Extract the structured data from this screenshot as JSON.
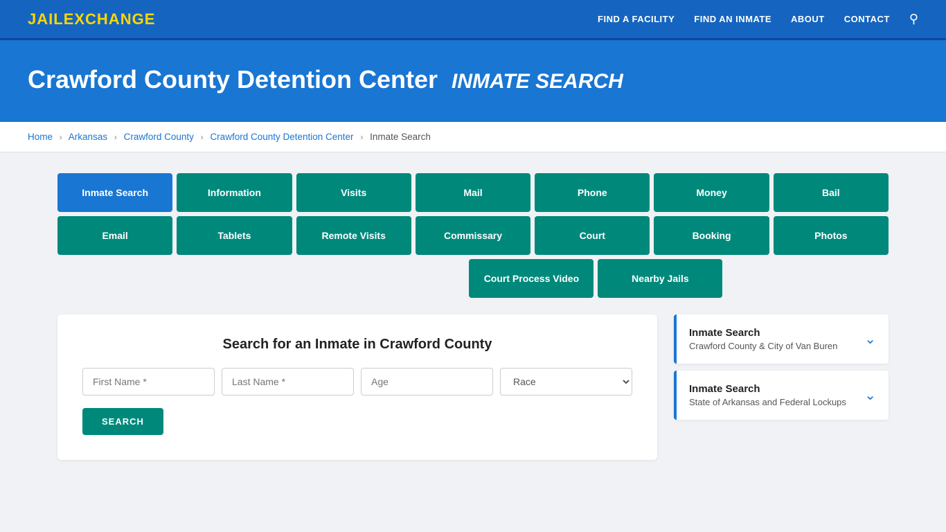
{
  "navbar": {
    "logo_jail": "JAIL",
    "logo_exchange": "EXCHANGE",
    "links": [
      {
        "label": "FIND A FACILITY",
        "href": "#"
      },
      {
        "label": "FIND AN INMATE",
        "href": "#"
      },
      {
        "label": "ABOUT",
        "href": "#"
      },
      {
        "label": "CONTACT",
        "href": "#"
      }
    ]
  },
  "hero": {
    "title": "Crawford County Detention Center",
    "subtitle": "INMATE SEARCH"
  },
  "breadcrumb": {
    "items": [
      {
        "label": "Home",
        "href": "#"
      },
      {
        "label": "Arkansas",
        "href": "#"
      },
      {
        "label": "Crawford County",
        "href": "#"
      },
      {
        "label": "Crawford County Detention Center",
        "href": "#"
      },
      {
        "label": "Inmate Search",
        "href": null
      }
    ]
  },
  "nav_buttons": {
    "row1": [
      {
        "label": "Inmate Search",
        "active": true
      },
      {
        "label": "Information",
        "active": false
      },
      {
        "label": "Visits",
        "active": false
      },
      {
        "label": "Mail",
        "active": false
      },
      {
        "label": "Phone",
        "active": false
      },
      {
        "label": "Money",
        "active": false
      },
      {
        "label": "Bail",
        "active": false
      }
    ],
    "row2": [
      {
        "label": "Email",
        "active": false
      },
      {
        "label": "Tablets",
        "active": false
      },
      {
        "label": "Remote Visits",
        "active": false
      },
      {
        "label": "Commissary",
        "active": false
      },
      {
        "label": "Court",
        "active": false
      },
      {
        "label": "Booking",
        "active": false
      },
      {
        "label": "Photos",
        "active": false
      }
    ],
    "row3": [
      {
        "label": "Court Process Video",
        "active": false
      },
      {
        "label": "Nearby Jails",
        "active": false
      }
    ]
  },
  "search_section": {
    "title": "Search for an Inmate in Crawford County",
    "fields": {
      "first_name_placeholder": "First Name *",
      "last_name_placeholder": "Last Name *",
      "age_placeholder": "Age",
      "race_placeholder": "Race"
    },
    "button_label": "SEARCH"
  },
  "sidebar": {
    "cards": [
      {
        "title": "Inmate Search",
        "subtitle": "Crawford County & City of Van Buren"
      },
      {
        "title": "Inmate Search",
        "subtitle": "State of Arkansas and Federal Lockups"
      }
    ]
  }
}
